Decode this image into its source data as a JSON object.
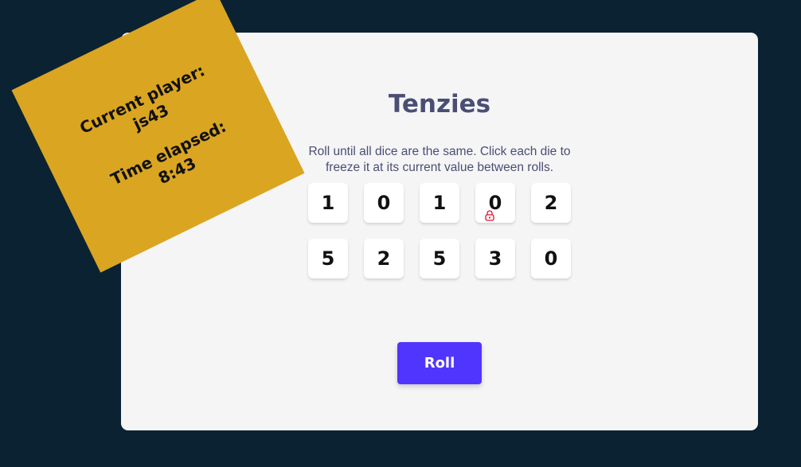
{
  "app": {
    "title": "Tenzies",
    "instructions": "Roll until all dice are the same. Click each die to freeze it at its current value between rolls."
  },
  "status_note": {
    "player_label": "Current player:",
    "player_name": "js43",
    "time_label": "Time elapsed:",
    "time_value": "8:43"
  },
  "dice": [
    {
      "value": "1",
      "held": false
    },
    {
      "value": "0",
      "held": false
    },
    {
      "value": "1",
      "held": false
    },
    {
      "value": "0",
      "held": true,
      "icon": "lock-icon"
    },
    {
      "value": "2",
      "held": false
    },
    {
      "value": "5",
      "held": false
    },
    {
      "value": "2",
      "held": false
    },
    {
      "value": "5",
      "held": false
    },
    {
      "value": "3",
      "held": false
    },
    {
      "value": "0",
      "held": false
    }
  ],
  "roll_button": {
    "label": "Roll"
  },
  "colors": {
    "background": "#0b2233",
    "board": "#f5f5f5",
    "title_text": "#4a4e74",
    "note": "#daa520",
    "button": "#5035ff",
    "lock_icon": "#e0102d"
  }
}
